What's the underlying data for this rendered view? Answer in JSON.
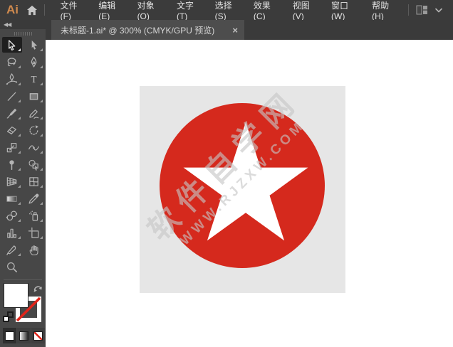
{
  "app": {
    "logo": "Ai"
  },
  "menubar": {
    "items": [
      {
        "label": "文件(F)"
      },
      {
        "label": "编辑(E)"
      },
      {
        "label": "对象(O)"
      },
      {
        "label": "文字(T)"
      },
      {
        "label": "选择(S)"
      },
      {
        "label": "效果(C)"
      },
      {
        "label": "视图(V)"
      },
      {
        "label": "窗口(W)"
      },
      {
        "label": "帮助(H)"
      }
    ]
  },
  "tabbar": {
    "active_tab": {
      "title": "未标题-1.ai* @ 300% (CMYK/GPU 预览)",
      "close_glyph": "×"
    }
  },
  "tool_panel": {
    "collapse_glyph": "◀◀",
    "type_tool_glyph": "T",
    "active_tool": "selection",
    "tools": [
      "selection",
      "direct-selection",
      "lasso",
      "pen",
      "curvature",
      "type",
      "line-segment",
      "rectangle",
      "paintbrush",
      "shaper-pencil",
      "eraser",
      "rotate",
      "scale",
      "width",
      "puppet-warp",
      "shape-builder",
      "perspective-grid",
      "mesh",
      "gradient",
      "eyedropper",
      "blend",
      "symbol-sprayer",
      "column-graph",
      "artboard",
      "slice",
      "hand",
      "zoom"
    ]
  },
  "canvas": {
    "artboard": {
      "background": "#e6e6e6",
      "circle_color": "#d5291d",
      "star_color": "#ffffff"
    },
    "watermark": {
      "line1": "软件自学网",
      "line2": "WWW.RJZXW.COM"
    }
  },
  "colors": {
    "menubar_bg": "#3b3b3b",
    "tab_active_bg": "#4d4d4d",
    "tool_rail_bg": "#474747",
    "logo_orange": "#d08a4e",
    "none_red": "#e0251a"
  }
}
